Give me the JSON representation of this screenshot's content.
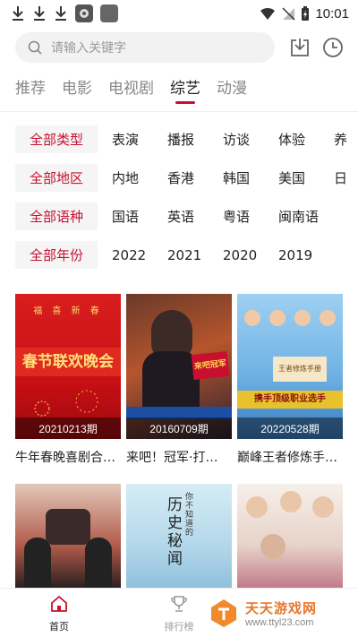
{
  "status_bar": {
    "time": "10:01",
    "colors": {
      "icon": "#333333"
    }
  },
  "search": {
    "placeholder": "请输入关键字"
  },
  "tabs": [
    {
      "label": "推荐",
      "active": false
    },
    {
      "label": "电影",
      "active": false
    },
    {
      "label": "电视剧",
      "active": false
    },
    {
      "label": "综艺",
      "active": true
    },
    {
      "label": "动漫",
      "active": false
    }
  ],
  "filters": [
    {
      "label": "全部类型",
      "options": [
        "表演",
        "播报",
        "访谈",
        "体验",
        "养"
      ]
    },
    {
      "label": "全部地区",
      "options": [
        "内地",
        "香港",
        "韩国",
        "美国",
        "日"
      ]
    },
    {
      "label": "全部语种",
      "options": [
        "国语",
        "英语",
        "粤语",
        "闽南语"
      ]
    },
    {
      "label": "全部年份",
      "options": [
        "2022",
        "2021",
        "2020",
        "2019"
      ]
    }
  ],
  "cards": [
    {
      "title": "牛年春晚喜剧合…",
      "episode": "20210213期",
      "poster_text": "春节联欢晚会",
      "poster_top": "福 喜 新 春"
    },
    {
      "title": "来吧！冠军·打…",
      "episode": "20160709期",
      "poster_text": "来吧冠军"
    },
    {
      "title": "巅峰王者修炼手…",
      "episode": "20220528期",
      "poster_text": "携手顶级职业选手",
      "poster_sub": "王者修炼手册"
    },
    {
      "title": "",
      "episode": "",
      "poster_text": ""
    },
    {
      "title": "",
      "episode": "",
      "poster_text": "历史秘闻",
      "poster_sub": "你不知道的"
    },
    {
      "title": "",
      "episode": "",
      "poster_text": ""
    }
  ],
  "bottom_nav": [
    {
      "label": "首页",
      "active": true
    },
    {
      "label": "排行榜",
      "active": false
    }
  ],
  "watermark": {
    "title": "天天游戏网",
    "url": "www.ttyl23.com"
  },
  "colors": {
    "accent": "#c8102e",
    "muted": "#888888"
  }
}
